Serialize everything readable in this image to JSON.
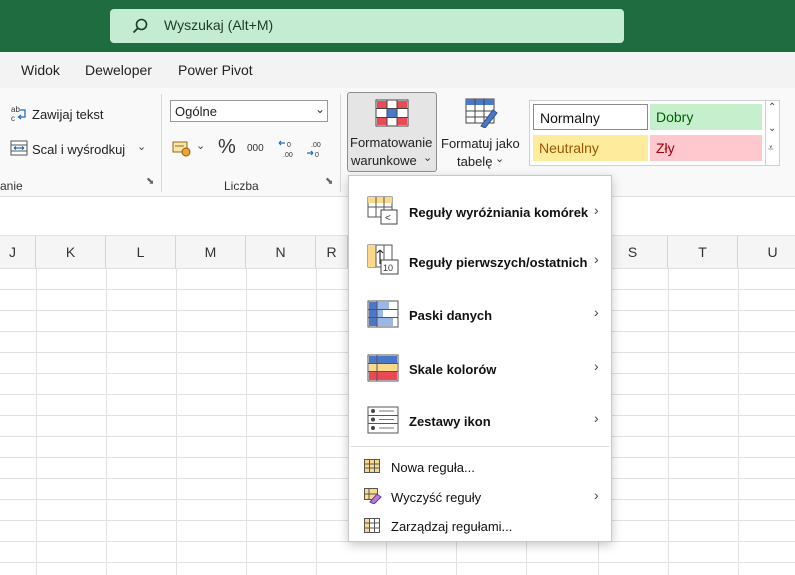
{
  "search": {
    "placeholder": "Wyszukaj (Alt+M)"
  },
  "menu_tabs": [
    "Widok",
    "Deweloper",
    "Power Pivot"
  ],
  "ribbon": {
    "wrap_text": "Zawijaj tekst",
    "merge_center": "Scal i wyśrodkuj",
    "alignment_group_fragment": "anie",
    "number_format_value": "Ogólne",
    "percent_symbol": "%",
    "thousands_symbol": "000",
    "number_group": "Liczba",
    "cond_format_line1": "Formatowanie",
    "cond_format_line2": "warunkowe",
    "format_table_line1": "Formatuj jako",
    "format_table_line2": "tabelę",
    "styles": {
      "normal": "Normalny",
      "good": "Dobry",
      "neutral": "Neutralny",
      "bad": "Zły"
    }
  },
  "columns": [
    "J",
    "K",
    "L",
    "M",
    "N",
    "R",
    "S",
    "T",
    "U"
  ],
  "dropdown": {
    "items": [
      {
        "label": "Reguły wyróżniania komórek",
        "icon": "highlight-rules-icon",
        "submenu": true
      },
      {
        "label": "Reguły pierwszych/ostatnich",
        "icon": "top-bottom-rules-icon",
        "submenu": true
      },
      {
        "label": "Paski danych",
        "icon": "data-bars-icon",
        "submenu": true
      },
      {
        "label": "Skale kolorów",
        "icon": "color-scales-icon",
        "submenu": true
      },
      {
        "label": "Zestawy ikon",
        "icon": "icon-sets-icon",
        "submenu": true
      }
    ],
    "actions": [
      {
        "label": "Nowa reguła...",
        "icon": "new-rule-icon",
        "submenu": false
      },
      {
        "label": "Wyczyść reguły",
        "icon": "clear-rules-icon",
        "submenu": true
      },
      {
        "label": "Zarządzaj regułami...",
        "icon": "manage-rules-icon",
        "submenu": false
      }
    ]
  },
  "colors": {
    "titlebar": "#1e6c40",
    "search_bg": "#c3ecd2",
    "good_bg": "#c6efce",
    "good_fg": "#006100",
    "neutral_bg": "#ffeb9c",
    "neutral_fg": "#9c5700",
    "bad_bg": "#ffc7ce",
    "bad_fg": "#9c0006"
  }
}
